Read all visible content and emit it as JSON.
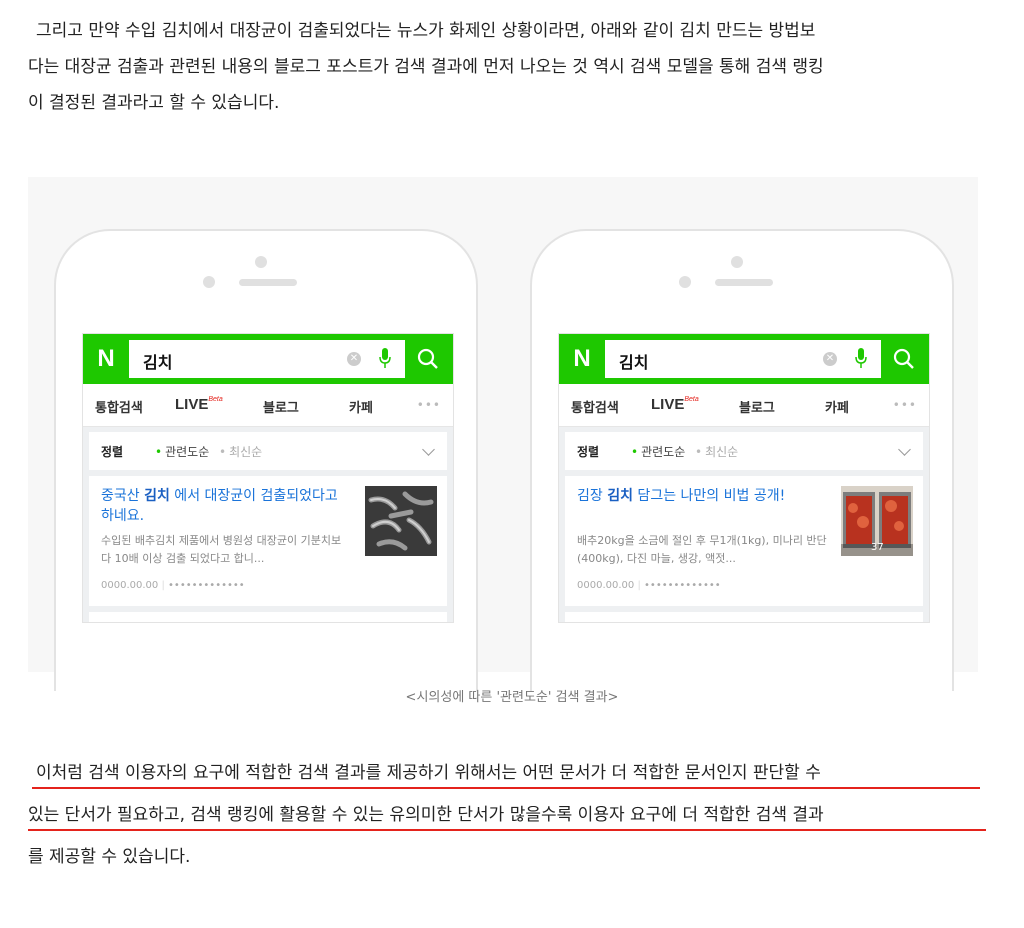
{
  "intro": {
    "lines": [
      "그리고 만약 수입 김치에서 대장균이 검출되었다는 뉴스가 화제인 상황이라면, 아래와 같이 김치 만드는 방법보",
      "다는 대장균 검출과 관련된 내용의 블로그 포스트가 검색 결과에 먼저 나오는 것 역시 검색 모델을 통해 검색 랭킹",
      "이 결정된 결과라고 할 수 있습니다."
    ]
  },
  "phones": [
    {
      "query": "김치",
      "tabs": [
        "통합검색",
        "LIVE",
        "블로그",
        "카페"
      ],
      "live_badge": "Beta",
      "more": "•••",
      "sort_label": "정렬",
      "sort_options": [
        "관련도순",
        "최신순"
      ],
      "result": {
        "title_pre": "중국산 ",
        "title_bold": "김치",
        "title_post": " 에서 대장균이 검출되었다고 하네요.",
        "desc": "수입된 배추김치 제품에서 병원성 대장균이 기분치보다 10배 이상 검출 되었다고 합니...",
        "date": "0000.00.00",
        "author": "•••••••••••••"
      }
    },
    {
      "query": "김치",
      "tabs": [
        "통합검색",
        "LIVE",
        "블로그",
        "카페"
      ],
      "live_badge": "Beta",
      "more": "•••",
      "sort_label": "정렬",
      "sort_options": [
        "관련도순",
        "최신순"
      ],
      "result": {
        "title_pre": "김장 ",
        "title_bold": "김치",
        "title_post": " 담그는 나만의 비법 공개!",
        "desc": "배추20kg을 소금에 절인 후 무1개(1kg), 미나리 반단(400kg), 다진 마늘, 생강, 액젓...",
        "date": "0000.00.00",
        "author": "•••••••••••••",
        "photo_count": "37"
      }
    }
  ],
  "caption": "<시의성에 따른 '관련도순' 검색 결과>",
  "conclusion": {
    "lines": [
      "이처럼 검색 이용자의 요구에 적합한 검색 결과를 제공하기 위해서는 어떤 문서가 더 적합한 문서인지 판단할 수",
      "있는 단서가 필요하고, 검색 랭킹에 활용할 수 있는 유의미한 단서가 많을수록 이용자 요구에 더 적합한 검색 결과",
      "를 제공할 수 있습니다."
    ]
  },
  "colors": {
    "naver_green": "#1ec800",
    "link_blue": "#1a73d9",
    "underline_red": "#e4231c"
  }
}
